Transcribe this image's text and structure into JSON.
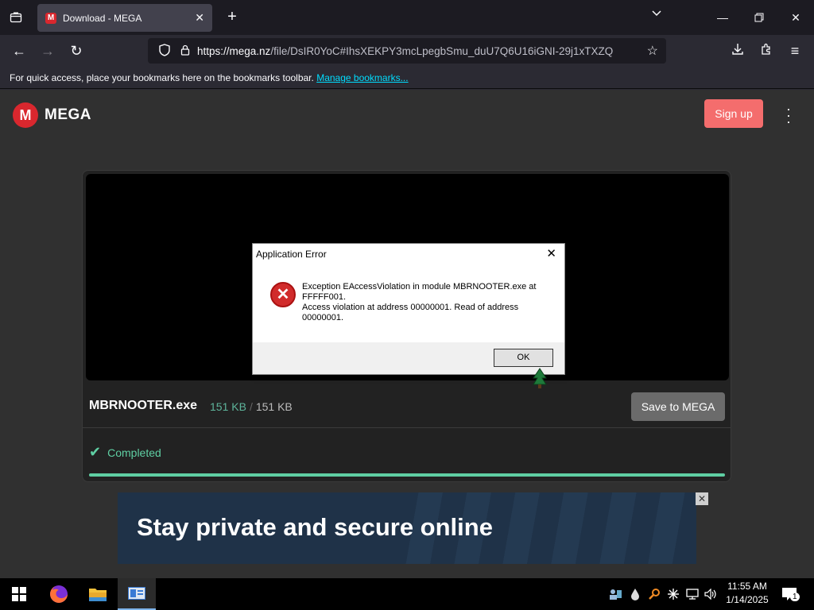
{
  "browser": {
    "tab_title": "Download - MEGA",
    "url_host": "https://mega.nz",
    "url_path": "/file/DsIR0YoC#IhsXEKPY3mcLpegbSmu_duU7Q6U16iGNI-29j1xTXZQ",
    "bookmarks_message": "For quick access, place your bookmarks here on the bookmarks toolbar.",
    "bookmarks_link": "Manage bookmarks..."
  },
  "mega": {
    "brand": "MEGA",
    "logo_letter": "M",
    "signup_label": "Sign up",
    "file_name": "MBRNOOTER.exe",
    "downloaded": "151 KB",
    "separator": "/",
    "total_size": "151 KB",
    "save_label": "Save to MEGA",
    "status": "Completed",
    "progress_percent": 100
  },
  "ad": {
    "headline": "Stay private and secure online"
  },
  "dialog": {
    "title": "Application Error",
    "message_line1": "Exception EAccessViolation in module MBRNOOTER.exe at FFFFF001.",
    "message_line2": "Access violation at address 00000001. Read of address 00000001.",
    "ok_label": "OK"
  },
  "taskbar": {
    "time": "11:55 AM",
    "date": "1/14/2025",
    "notification_count": "1"
  },
  "colors": {
    "mega_red": "#d9272e",
    "signup_bg": "#f46d6d",
    "success_green": "#5fcfa3",
    "firefox_link": "#00ddff"
  }
}
